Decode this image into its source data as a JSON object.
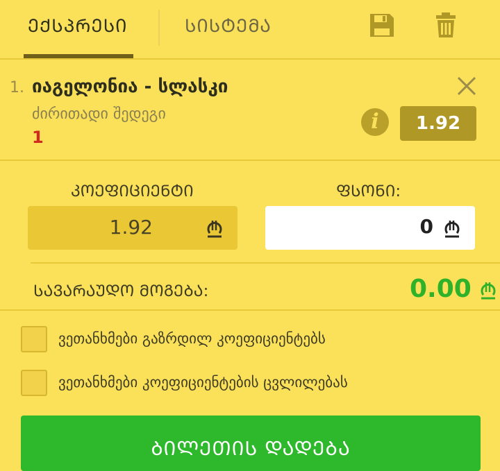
{
  "tabs": [
    {
      "label": "ᲔᲥᲡᲞᲠᲔᲡᲘ",
      "active": true
    },
    {
      "label": "ᲡᲘᲡᲢᲔᲛᲐ",
      "active": false
    }
  ],
  "toolbar": {
    "save_icon": "save-icon",
    "delete_icon": "trash-icon"
  },
  "selection": {
    "index": "1.",
    "title": "იაგელონია - სლასკი",
    "market": "ძირითადი შედეგი",
    "pick": "1",
    "odds": "1.92",
    "info_label": "i"
  },
  "bet": {
    "coefficient_label": "ᲙᲝᲔᲤᲘᲪᲘᲔᲜᲢᲘ",
    "coefficient_value": "1.92",
    "stake_label": "ᲤᲡᲝᲜᲘ:",
    "stake_value": "0",
    "possible_win_label": "ᲡᲐᲕᲐᲠᲐᲣᲓᲝ ᲛᲝᲒᲔᲑᲐ:",
    "possible_win_value": "0.00"
  },
  "agreements": [
    {
      "label": "ვეთანხმები გაზრდილ კოეფიციენტებს",
      "checked": false
    },
    {
      "label": "ვეთანხმები კოეფიციენტების ცვლილებას",
      "checked": false
    }
  ],
  "submit": {
    "label": "ᲑᲘᲚᲔᲗᲘᲡ ᲓᲐᲓᲔᲑᲐ"
  },
  "colors": {
    "background": "#fbe15a",
    "accent_dark": "#b09827",
    "win_green": "#2fb22a",
    "button_green": "#2eb82c",
    "pick_red": "#d12b1f"
  }
}
